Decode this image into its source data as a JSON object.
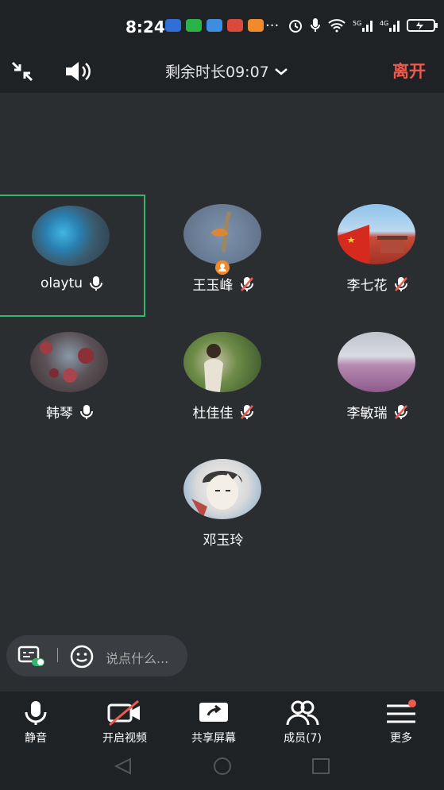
{
  "status": {
    "time": "8:24",
    "dots": "···"
  },
  "header": {
    "remaining": "剩余时长09:07",
    "leave": "离开"
  },
  "participants": [
    {
      "name": "olaytu"
    },
    {
      "name": "王玉峰"
    },
    {
      "name": "李七花"
    },
    {
      "name": "韩琴"
    },
    {
      "name": "杜佳佳"
    },
    {
      "name": "李敏瑞"
    },
    {
      "name": "邓玉玲"
    }
  ],
  "chat": {
    "placeholder": "说点什么..."
  },
  "toolbar": {
    "mute": "静音",
    "video": "开启视频",
    "share": "共享屏幕",
    "members": "成员(7)",
    "more": "更多"
  },
  "colors": {
    "accent_red": "#ef5a4f",
    "active_green": "#36b56d"
  }
}
